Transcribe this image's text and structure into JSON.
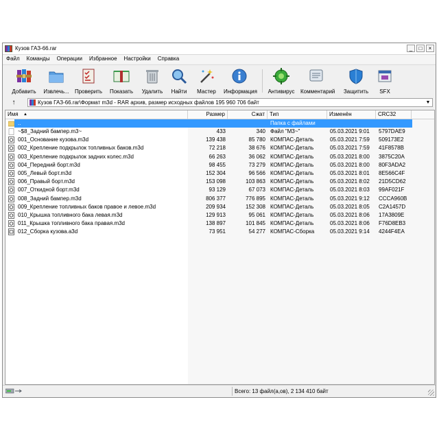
{
  "window": {
    "title": "Кузов ГАЗ-66.rar",
    "buttons": {
      "minimize": "_",
      "maximize": "□",
      "close": "×"
    }
  },
  "menu": [
    "Файл",
    "Команды",
    "Операции",
    "Избранное",
    "Настройки",
    "Справка"
  ],
  "toolbar": [
    {
      "label": "Добавить",
      "icon": "archive-books-icon"
    },
    {
      "label": "Извлечь...",
      "icon": "folder-extract-icon"
    },
    {
      "label": "Проверить",
      "icon": "checklist-icon"
    },
    {
      "label": "Показать",
      "icon": "open-book-icon"
    },
    {
      "label": "Удалить",
      "icon": "trash-can-icon"
    },
    {
      "label": "Найти",
      "icon": "magnifier-icon"
    },
    {
      "label": "Мастер",
      "icon": "magic-wand-icon"
    },
    {
      "label": "Информация",
      "icon": "info-icon"
    },
    {
      "label": "Антивирус",
      "icon": "antivirus-icon"
    },
    {
      "label": "Комментарий",
      "icon": "comment-icon"
    },
    {
      "label": "Защитить",
      "icon": "shield-icon"
    },
    {
      "label": "SFX",
      "icon": "sfx-icon"
    }
  ],
  "address": {
    "text": "Кузов ГАЗ-66.rar\\Формат m3d - RAR архив, размер исходных файлов 195 960 706 байт",
    "up_icon": "up-arrow-icon"
  },
  "columns": {
    "name": "Имя",
    "size": "Размер",
    "packed": "Сжат",
    "type": "Тип",
    "modified": "Изменён",
    "crc": "CRC32"
  },
  "folder_row": {
    "name": "..",
    "type": "Папка с файлами"
  },
  "files": [
    {
      "name": "~$8_Задний бампер.m3~",
      "size": "433",
      "packed": "340",
      "type": "Файл \"M3~\"",
      "modified": "05.03.2021 9:01",
      "crc": "5797DAE9",
      "icon": "blank-file-icon"
    },
    {
      "name": "001_Основание кузова.m3d",
      "size": "139 438",
      "packed": "85 780",
      "type": "КОМПАС-Деталь",
      "modified": "05.03.2021 7:59",
      "crc": "509173E2",
      "icon": "kompas-part-icon"
    },
    {
      "name": "002_Крепление подкрылок топливных баков.m3d",
      "size": "72 218",
      "packed": "38 676",
      "type": "КОМПАС-Деталь",
      "modified": "05.03.2021 7:59",
      "crc": "41F8578B",
      "icon": "kompas-part-icon"
    },
    {
      "name": "003_Крепление подкрылок задних колес.m3d",
      "size": "66 263",
      "packed": "36 062",
      "type": "КОМПАС-Деталь",
      "modified": "05.03.2021 8:00",
      "crc": "3875C20A",
      "icon": "kompas-part-icon"
    },
    {
      "name": "004_Передний борт.m3d",
      "size": "98 455",
      "packed": "73 279",
      "type": "КОМПАС-Деталь",
      "modified": "05.03.2021 8:00",
      "crc": "80F3ADA2",
      "icon": "kompas-part-icon"
    },
    {
      "name": "005_Левый борт.m3d",
      "size": "152 304",
      "packed": "96 566",
      "type": "КОМПАС-Деталь",
      "modified": "05.03.2021 8:01",
      "crc": "8E566C4F",
      "icon": "kompas-part-icon"
    },
    {
      "name": "006_Правый борт.m3d",
      "size": "153 098",
      "packed": "103 863",
      "type": "КОМПАС-Деталь",
      "modified": "05.03.2021 8:02",
      "crc": "21D5CD62",
      "icon": "kompas-part-icon"
    },
    {
      "name": "007_Откидной борт.m3d",
      "size": "93 129",
      "packed": "67 073",
      "type": "КОМПАС-Деталь",
      "modified": "05.03.2021 8:03",
      "crc": "99AF021F",
      "icon": "kompas-part-icon"
    },
    {
      "name": "008_Задний бампер.m3d",
      "size": "806 377",
      "packed": "776 895",
      "type": "КОМПАС-Деталь",
      "modified": "05.03.2021 9:12",
      "crc": "CCCA960B",
      "icon": "kompas-part-icon"
    },
    {
      "name": "009_Крепление топливных баков правое и левое.m3d",
      "size": "209 934",
      "packed": "152 308",
      "type": "КОМПАС-Деталь",
      "modified": "05.03.2021 8:05",
      "crc": "C2A1457D",
      "icon": "kompas-part-icon"
    },
    {
      "name": "010_Крышка топливного бака левая.m3d",
      "size": "129 913",
      "packed": "95 061",
      "type": "КОМПАС-Деталь",
      "modified": "05.03.2021 8:06",
      "crc": "17A3809E",
      "icon": "kompas-part-icon"
    },
    {
      "name": "011_Крышка топливного бака правая.m3d",
      "size": "138 897",
      "packed": "101 845",
      "type": "КОМПАС-Деталь",
      "modified": "05.03.2021 8:06",
      "crc": "F76D8EB3",
      "icon": "kompas-part-icon"
    },
    {
      "name": "012_Сборка кузова.a3d",
      "size": "73 951",
      "packed": "54 277",
      "type": "КОМПАС-Сборка",
      "modified": "05.03.2021 9:14",
      "crc": "4244F4EA",
      "icon": "kompas-assembly-icon"
    }
  ],
  "status": {
    "text": "Всего: 13 файл(а,ов), 2 134 410 байт"
  },
  "colors": {
    "selection": "#3399ff"
  }
}
